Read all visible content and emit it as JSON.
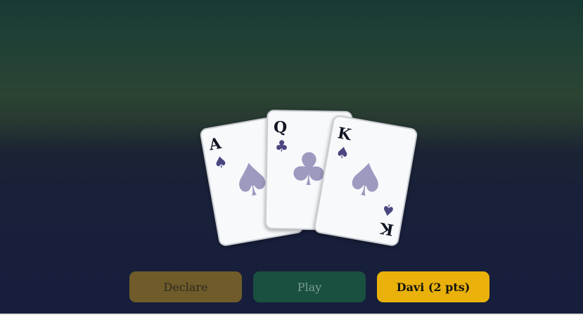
{
  "hand": {
    "cards": [
      {
        "rank": "A",
        "suit": "spade",
        "suit_glyph": "♠"
      },
      {
        "rank": "Q",
        "suit": "club",
        "suit_glyph": "♣"
      },
      {
        "rank": "K",
        "suit": "spade",
        "suit_glyph": "♠"
      }
    ]
  },
  "actions": {
    "declare_label": "Declare",
    "play_label": "Play",
    "player_label": "Davi (2 pts)"
  },
  "colors": {
    "declare": "#6f5c2a",
    "play": "#1a5040",
    "player": "#e9b10a",
    "pip": "#4a4680"
  }
}
